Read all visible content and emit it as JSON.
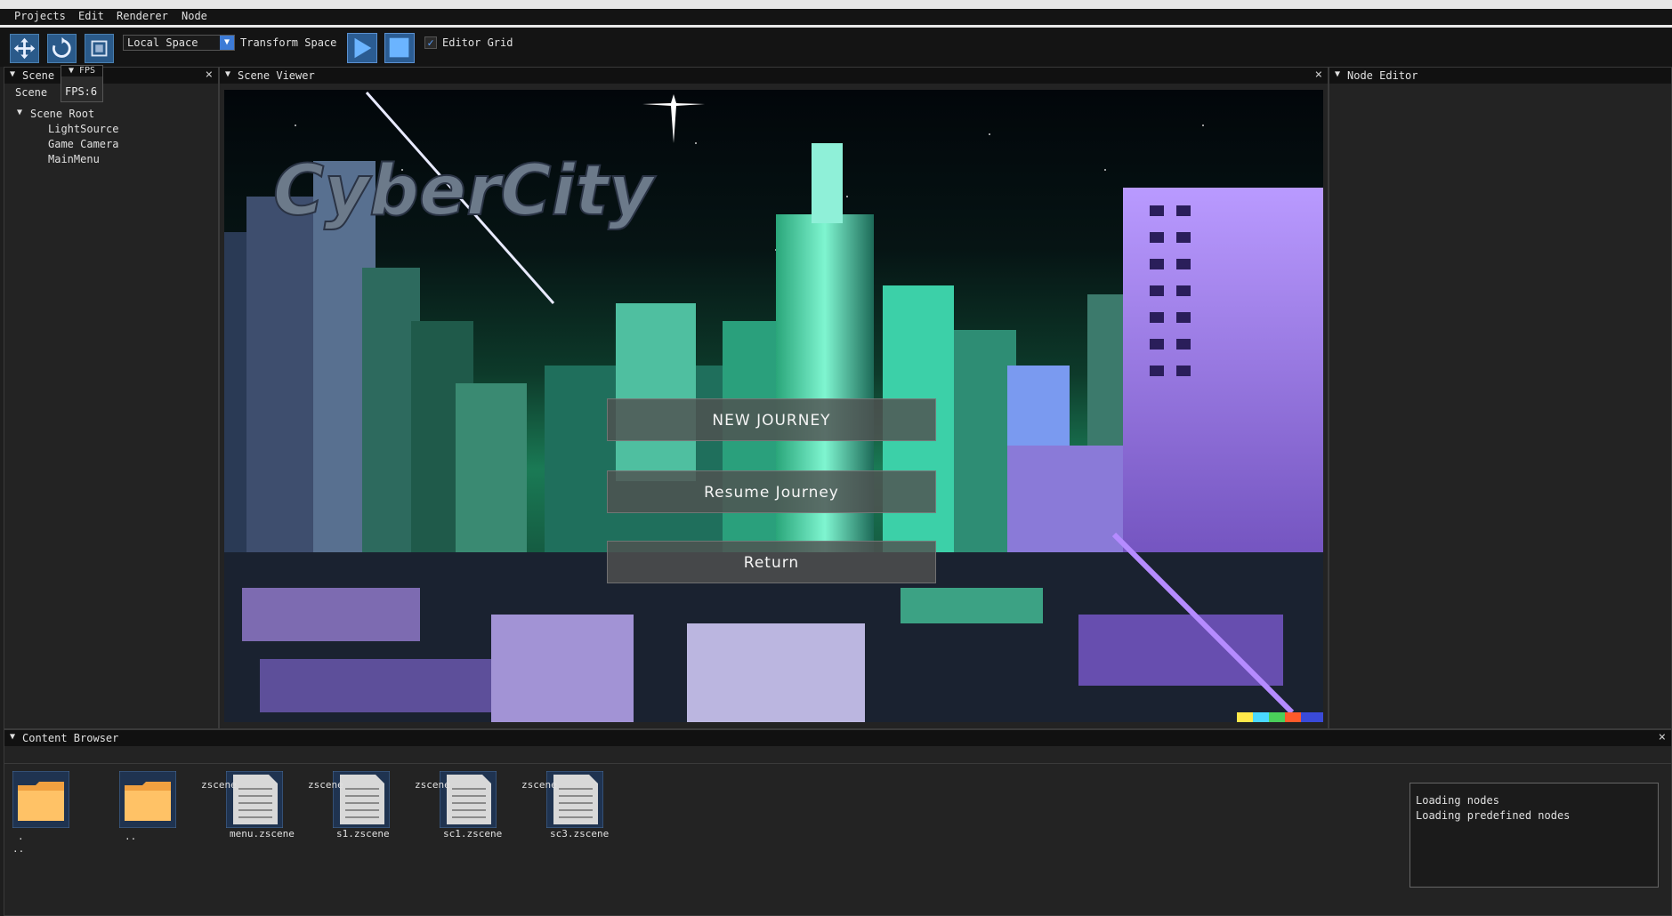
{
  "menubar": {
    "items": [
      "Projects",
      "Edit",
      "Renderer",
      "Node"
    ]
  },
  "toolbar": {
    "tools": [
      "move-tool-icon",
      "rotate-tool-icon",
      "scale-tool-icon"
    ],
    "space_select": "Local Space",
    "transform_space_label": "Transform Space",
    "editor_grid_label": "Editor Grid",
    "editor_grid_checked": true
  },
  "scene_panel": {
    "title": "Scene",
    "tab": "Scene",
    "fps_window_title": "FPS",
    "fps_value": "FPS:6",
    "tree": {
      "root": "Scene Root",
      "children": [
        "LightSource",
        "Game Camera",
        "MainMenu"
      ]
    }
  },
  "viewer_panel": {
    "title": "Scene Viewer",
    "game_title": "CyberCity",
    "buttons": [
      "NEW JOURNEY",
      "Resume Journey",
      "Return"
    ]
  },
  "node_panel": {
    "title": "Node Editor"
  },
  "content_browser": {
    "title": "Content Browser",
    "folders": [
      ".",
      ".."
    ],
    "files": [
      {
        "label": "menu.zscene",
        "ext": "zscene"
      },
      {
        "label": "s1.zscene",
        "ext": "zscene"
      },
      {
        "label": "sc1.zscene",
        "ext": "zscene"
      },
      {
        "label": "sc3.zscene",
        "ext": "zscene"
      }
    ],
    "footer": "..",
    "log": [
      "Loading nodes",
      "Loading predefined nodes"
    ]
  },
  "colors": {
    "accent": "#3d7bd6",
    "panel_bg": "#232323",
    "title_bg": "#111111"
  }
}
